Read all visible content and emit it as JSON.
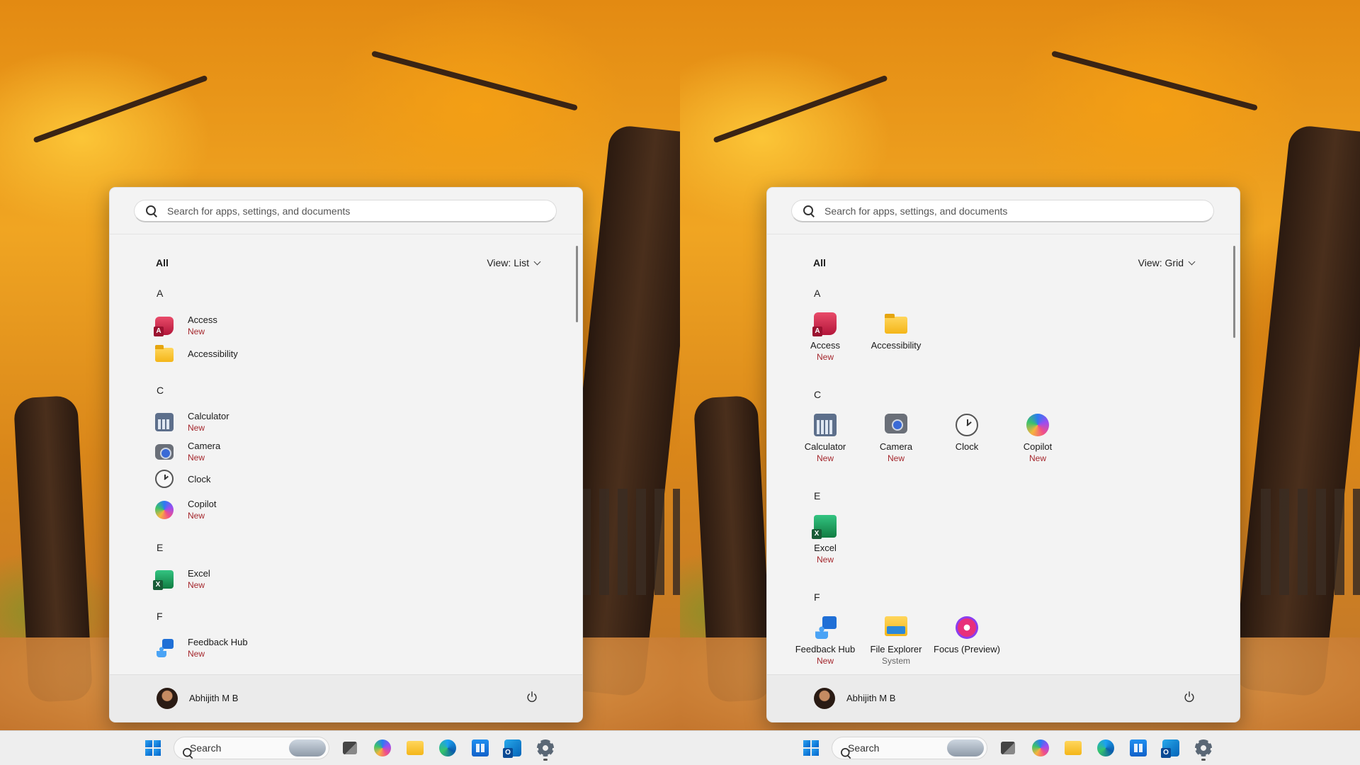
{
  "left": {
    "search_placeholder": "Search for apps, settings, and documents",
    "all_label": "All",
    "view_label": "View: List",
    "letters": {
      "a": "A",
      "c": "C",
      "e": "E",
      "f": "F"
    },
    "apps": [
      {
        "name": "Access",
        "badge": "New",
        "icon": "access-icon"
      },
      {
        "name": "Accessibility",
        "badge": "",
        "icon": "folder-icon"
      },
      {
        "name": "Calculator",
        "badge": "New",
        "icon": "calculator-icon"
      },
      {
        "name": "Camera",
        "badge": "New",
        "icon": "camera-icon"
      },
      {
        "name": "Clock",
        "badge": "",
        "icon": "clock-icon"
      },
      {
        "name": "Copilot",
        "badge": "New",
        "icon": "copilot-icon"
      },
      {
        "name": "Excel",
        "badge": "New",
        "icon": "excel-icon"
      },
      {
        "name": "Feedback Hub",
        "badge": "New",
        "icon": "feedback-hub-icon"
      }
    ],
    "user_name": "Abhijith M B",
    "taskbar_search": "Search"
  },
  "right": {
    "search_placeholder": "Search for apps, settings, and documents",
    "all_label": "All",
    "view_label": "View: Grid",
    "letters": {
      "a": "A",
      "c": "C",
      "e": "E",
      "f": "F"
    },
    "apps": [
      {
        "name": "Access",
        "badge": "New",
        "icon": "access-icon"
      },
      {
        "name": "Accessibility",
        "badge": "",
        "icon": "folder-icon"
      },
      {
        "name": "Calculator",
        "badge": "New",
        "icon": "calculator-icon"
      },
      {
        "name": "Camera",
        "badge": "New",
        "icon": "camera-icon"
      },
      {
        "name": "Clock",
        "badge": "",
        "icon": "clock-icon"
      },
      {
        "name": "Copilot",
        "badge": "New",
        "icon": "copilot-icon"
      },
      {
        "name": "Excel",
        "badge": "New",
        "icon": "excel-icon"
      },
      {
        "name": "Feedback Hub",
        "badge": "New",
        "icon": "feedback-hub-icon"
      },
      {
        "name": "File Explorer",
        "badge": "System",
        "icon": "file-explorer-icon"
      },
      {
        "name": "Focus (Preview)",
        "badge": "",
        "icon": "focus-icon"
      }
    ],
    "user_name": "Abhijith M B",
    "taskbar_search": "Search"
  },
  "colors": {
    "new_badge": "#a4262c",
    "menu_bg": "#f3f3f3",
    "taskbar_bg": "#eeeeee"
  }
}
